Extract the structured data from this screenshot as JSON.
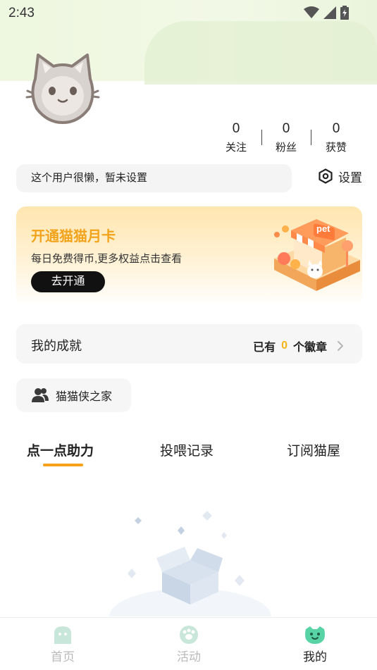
{
  "status_bar": {
    "time": "2:43"
  },
  "profile": {
    "stats": [
      {
        "value": "0",
        "label": "关注"
      },
      {
        "value": "0",
        "label": "粉丝"
      },
      {
        "value": "0",
        "label": "获赞"
      }
    ],
    "bio": "这个用户很懒，暂未设置",
    "settings_label": "设置"
  },
  "vip_card": {
    "title": "开通猫猫月卡",
    "description": "每日免费得币,更多权益点击查看",
    "button_label": "去开通",
    "illustration_sign": "pet",
    "accent_color": "#f2a31c"
  },
  "achievements": {
    "title": "我的成就",
    "prefix": "已有",
    "count": "0",
    "suffix": "个徽章"
  },
  "club": {
    "label": "猫猫侠之家"
  },
  "tabs": [
    {
      "label": "点一点助力",
      "active": true
    },
    {
      "label": "投喂记录",
      "active": false
    },
    {
      "label": "订阅猫屋",
      "active": false
    }
  ],
  "bottom_nav": [
    {
      "label": "首页",
      "icon": "home-icon",
      "active": false
    },
    {
      "label": "活动",
      "icon": "paw-icon",
      "active": false
    },
    {
      "label": "我的",
      "icon": "cat-face-icon",
      "active": true
    }
  ],
  "colors": {
    "accent_orange": "#f5a11a",
    "nav_active_green": "#57d3a6"
  }
}
